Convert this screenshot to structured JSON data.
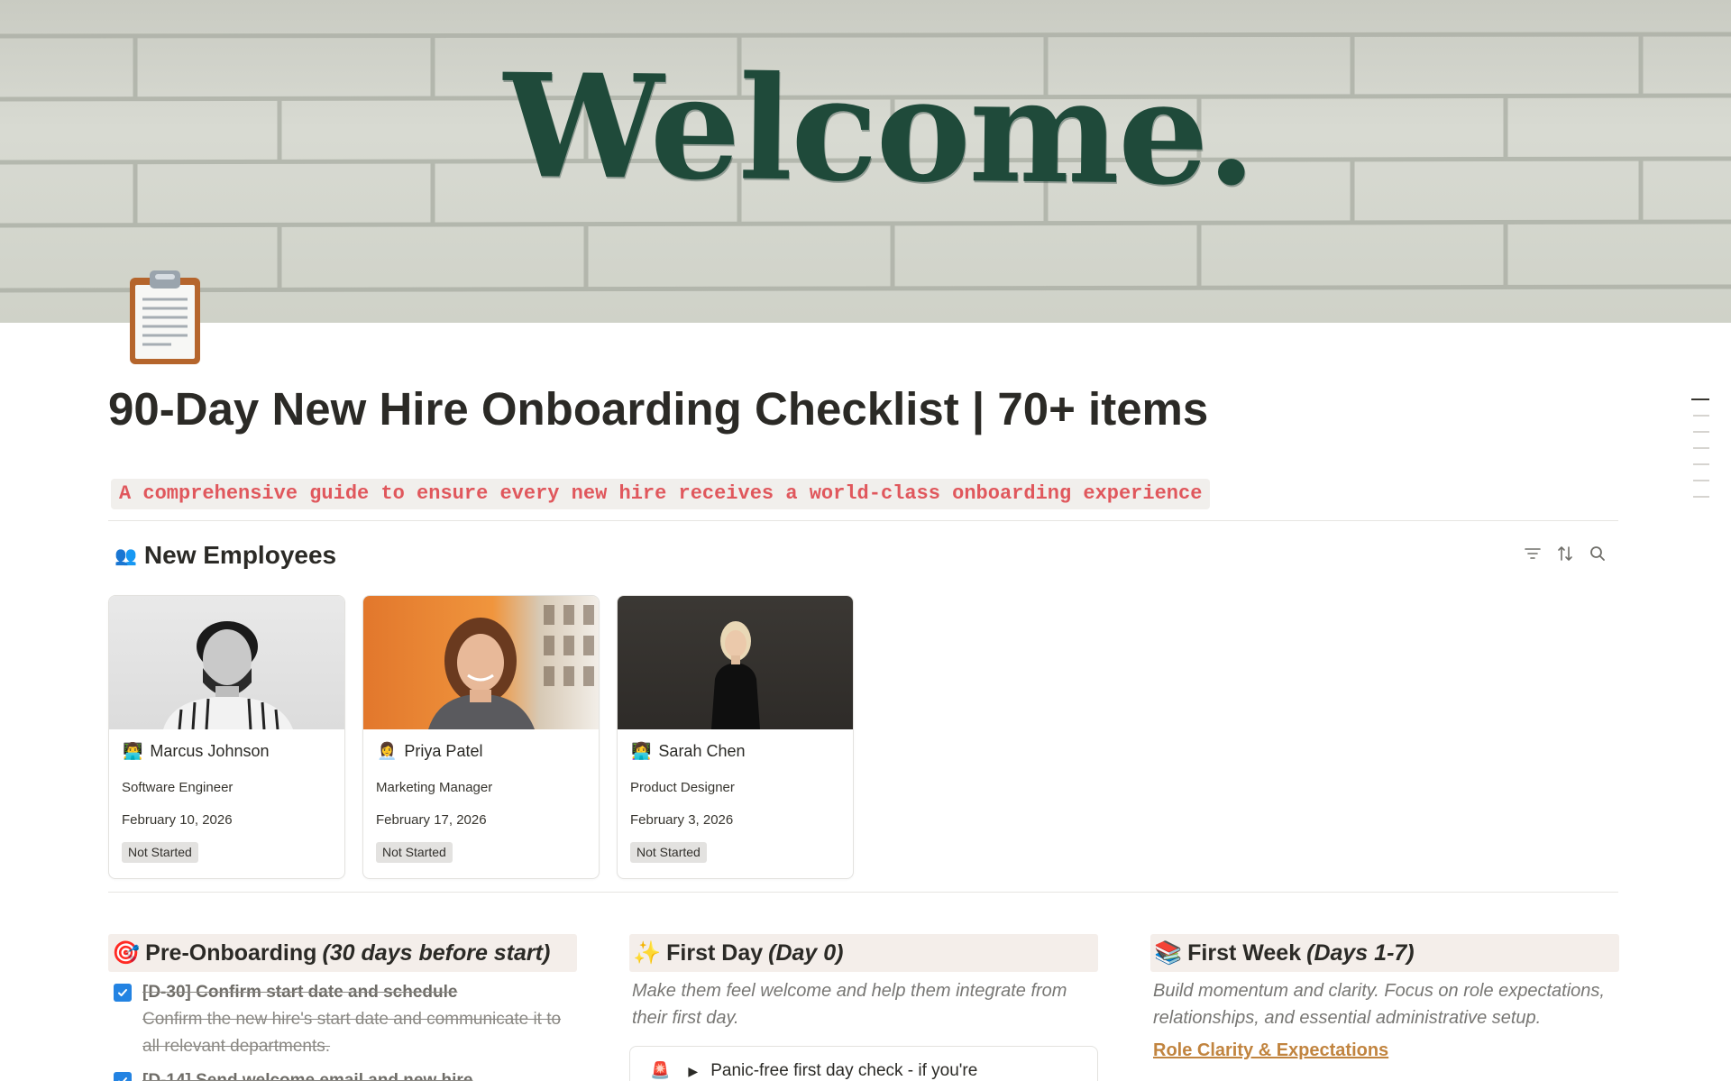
{
  "cover": {
    "text": "Welcome."
  },
  "page": {
    "icon": "clipboard-icon",
    "title": "90-Day New Hire Onboarding Checklist | 70+ items",
    "subtitle": "A comprehensive guide to ensure every new hire receives a world-class onboarding experience"
  },
  "database": {
    "icon": "busts-in-silhouette-icon",
    "title": "New Employees",
    "tools": [
      "filter-icon",
      "sort-icon",
      "search-icon"
    ],
    "cards": [
      {
        "emoji": "👨‍💻",
        "name": "Marcus Johnson",
        "role": "Software Engineer",
        "date": "February 10, 2026",
        "status": "Not Started"
      },
      {
        "emoji": "👩‍💼",
        "name": "Priya Patel",
        "role": "Marketing Manager",
        "date": "February 17, 2026",
        "status": "Not Started"
      },
      {
        "emoji": "👩‍💻",
        "name": "Sarah Chen",
        "role": "Product Designer",
        "date": "February 3, 2026",
        "status": "Not Started"
      }
    ]
  },
  "columns": {
    "pre": {
      "emoji": "🎯",
      "title": "Pre-Onboarding",
      "subtitle": "(30 days before start)",
      "todos": [
        {
          "title": "[D-30] Confirm start date and schedule",
          "desc": "Confirm the new hire's start date and communicate it to all relevant departments.",
          "checked": true
        },
        {
          "title": "[D-14] Send welcome email and new hire",
          "desc": "",
          "checked": true
        }
      ]
    },
    "first_day": {
      "emoji": "✨",
      "title": "First Day",
      "subtitle": "(Day 0)",
      "desc": "Make them feel welcome and help them integrate from their first day.",
      "callout": {
        "emoji": "🚨",
        "text": "Panic-free first day check - if you're"
      }
    },
    "first_week": {
      "emoji": "📚",
      "title": "First Week",
      "subtitle": "(Days 1-7)",
      "desc": "Build momentum and clarity. Focus on role expectations, relationships, and essential administrative setup.",
      "link": "Role Clarity & Expectations"
    }
  },
  "colors": {
    "accent": "#2383e2",
    "subtitle_text": "#e0575c",
    "heading_bg": "#f4eeea",
    "link": "#c1843f",
    "badge_bg": "#e3e2e0"
  }
}
